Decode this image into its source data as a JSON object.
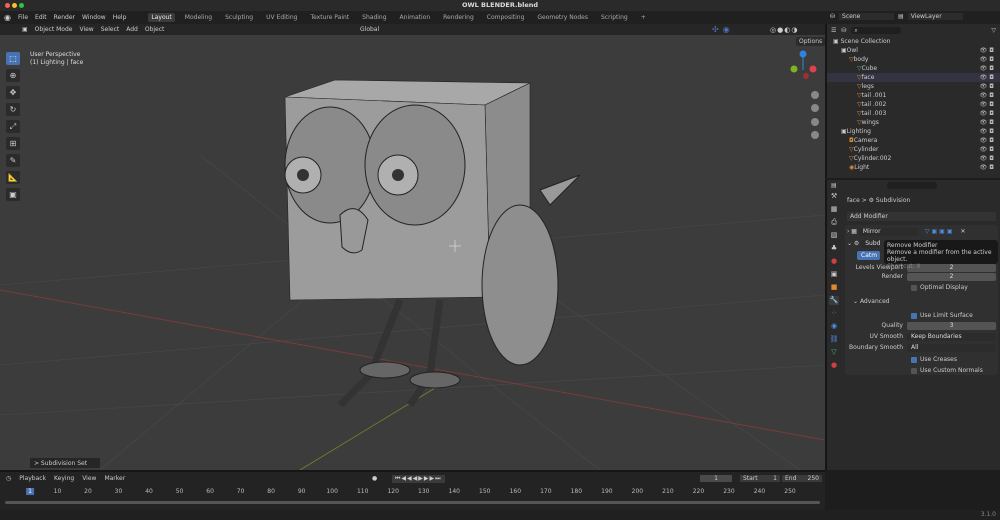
{
  "window": {
    "title": "OWL BLENDER.blend",
    "version": "3.1.0"
  },
  "menu": [
    "File",
    "Edit",
    "Render",
    "Window",
    "Help"
  ],
  "workspaces": [
    "Layout",
    "Modeling",
    "Sculpting",
    "UV Editing",
    "Texture Paint",
    "Shading",
    "Animation",
    "Rendering",
    "Compositing",
    "Geometry Nodes",
    "Scripting",
    "+"
  ],
  "viewport": {
    "mode": "Object Mode",
    "menus": [
      "View",
      "Select",
      "Add",
      "Object"
    ],
    "orientation": "Global",
    "options": "Options",
    "overlay_line1": "User Perspective",
    "overlay_line2": "(1) Lighting | face",
    "last_op": "> Subdivision Set"
  },
  "scene": {
    "scene": "Scene",
    "view_layer": "ViewLayer"
  },
  "outliner": {
    "root": "Scene Collection",
    "items": [
      {
        "name": "Owl",
        "depth": 1,
        "type": "collection"
      },
      {
        "name": "body",
        "depth": 2,
        "type": "mesh"
      },
      {
        "name": "Cube",
        "depth": 3,
        "type": "data"
      },
      {
        "name": "face",
        "depth": 3,
        "type": "mesh"
      },
      {
        "name": "legs",
        "depth": 3,
        "type": "mesh"
      },
      {
        "name": "tail .001",
        "depth": 3,
        "type": "mesh"
      },
      {
        "name": "tail .002",
        "depth": 3,
        "type": "mesh"
      },
      {
        "name": "tail .003",
        "depth": 3,
        "type": "mesh"
      },
      {
        "name": "wings",
        "depth": 3,
        "type": "mesh"
      },
      {
        "name": "Lighting",
        "depth": 1,
        "type": "collection"
      },
      {
        "name": "Camera",
        "depth": 2,
        "type": "camera"
      },
      {
        "name": "Cylinder",
        "depth": 2,
        "type": "mesh"
      },
      {
        "name": "Cylinder.002",
        "depth": 2,
        "type": "mesh"
      },
      {
        "name": "Light",
        "depth": 2,
        "type": "light"
      }
    ]
  },
  "properties": {
    "object": "face",
    "modifier": "Subdivision",
    "add_modifier": "Add Modifier",
    "mirror": "Mirror",
    "subd_short": "Subd",
    "catmull": "Catm",
    "levels_viewport_label": "Levels Viewport",
    "levels_viewport": "2",
    "render_label": "Render",
    "render": "2",
    "optimal_display": "Optimal Display",
    "advanced": "Advanced",
    "use_limit_surface": "Use Limit Surface",
    "quality_label": "Quality",
    "quality": "3",
    "uv_smooth_label": "UV Smooth",
    "uv_smooth": "Keep Boundaries",
    "boundary_smooth_label": "Boundary Smooth",
    "boundary_smooth": "All",
    "use_creases": "Use Creases",
    "use_custom_normals": "Use Custom Normals"
  },
  "tooltip": {
    "title": "Remove Modifier",
    "desc": "Remove a modifier from the active object.",
    "shortcut": "Shortcut: X"
  },
  "timeline": {
    "menus": [
      "Playback",
      "Keying",
      "View",
      "Marker"
    ],
    "current_frame": "1",
    "start_label": "Start",
    "start": "1",
    "end_label": "End",
    "end": "250",
    "ticks": [
      "1",
      "10",
      "20",
      "30",
      "40",
      "50",
      "60",
      "70",
      "80",
      "90",
      "100",
      "110",
      "120",
      "130",
      "140",
      "150",
      "160",
      "170",
      "180",
      "190",
      "200",
      "210",
      "220",
      "230",
      "240",
      "250"
    ]
  },
  "colors": {
    "accent": "#4772b3",
    "bg": "#3c3c3c"
  }
}
